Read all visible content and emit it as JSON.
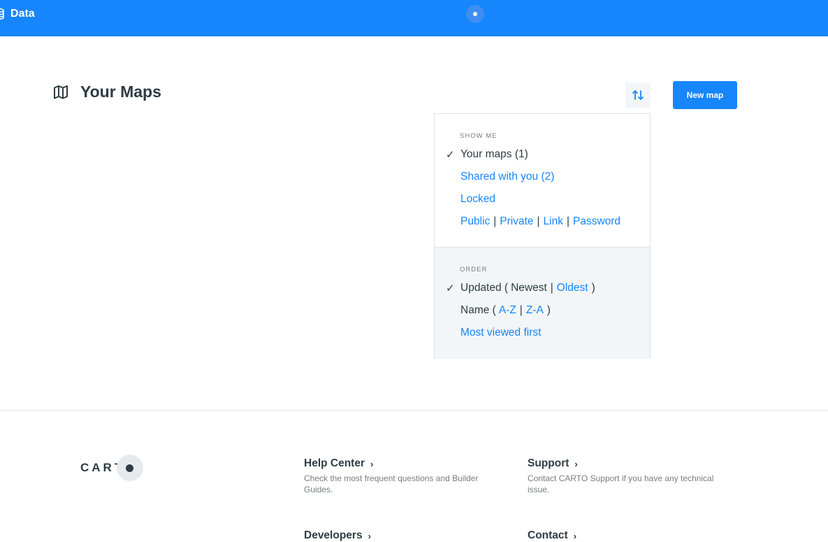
{
  "topbar": {
    "data_label": "Data"
  },
  "page": {
    "title": "Your Maps",
    "new_map_label": "New map"
  },
  "dropdown": {
    "show_me": {
      "heading": "SHOW ME",
      "your_maps": "Your maps (1)",
      "shared": "Shared with you (2)",
      "locked": "Locked",
      "privacy": [
        "Public",
        "Private",
        "Link",
        "Password"
      ],
      "sep": "|"
    },
    "order": {
      "heading": "ORDER",
      "updated_prefix": "Updated (",
      "newest": "Newest",
      "oldest": "Oldest",
      "name_prefix": "Name (",
      "az": "A-Z",
      "za": "Z-A",
      "close_paren": ")",
      "sep": "|",
      "most_viewed": "Most viewed first"
    },
    "check": "✓"
  },
  "footer": {
    "logo_text": "CART",
    "help": {
      "title": "Help Center",
      "desc": "Check the most frequent questions and Builder Guides."
    },
    "support": {
      "title": "Support",
      "desc": "Contact CARTO Support if you have any technical issue."
    },
    "developers": {
      "title": "Developers"
    },
    "contact": {
      "title": "Contact"
    },
    "chevron": "›"
  },
  "colors": {
    "brand_blue": "#1785fb",
    "text_dark": "#2e3c43",
    "muted": "#747d82",
    "panel_gray": "#f2f6f9"
  },
  "icons": {
    "data": "database-icon",
    "maps": "map-icon",
    "sort": "sort-arrows-icon",
    "status": "status-dot-icon"
  }
}
